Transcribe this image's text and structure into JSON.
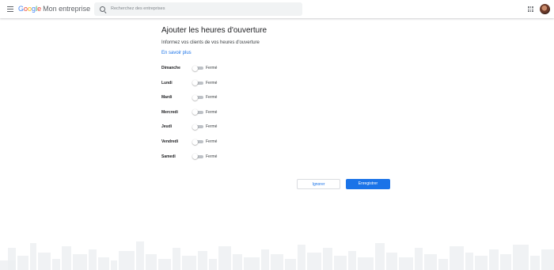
{
  "header": {
    "logo_google": "Google",
    "logo_product": "Mon entreprise",
    "search_placeholder": "Recherchez des entreprises"
  },
  "main": {
    "title": "Ajouter les heures d'ouverture",
    "subtitle": "Informez vos clients de vos heures d'ouverture",
    "learn_more": "En savoir plus"
  },
  "days": [
    {
      "name": "Dimanche",
      "status": "Fermé",
      "open": false
    },
    {
      "name": "Lundi",
      "status": "Fermé",
      "open": false
    },
    {
      "name": "Mardi",
      "status": "Fermé",
      "open": false
    },
    {
      "name": "Mercredi",
      "status": "Fermé",
      "open": false
    },
    {
      "name": "Jeudi",
      "status": "Fermé",
      "open": false
    },
    {
      "name": "Vendredi",
      "status": "Fermé",
      "open": false
    },
    {
      "name": "Samedi",
      "status": "Fermé",
      "open": false
    }
  ],
  "actions": {
    "ignore_label": "Ignorer",
    "save_label": "Enregistrer"
  },
  "colors": {
    "accent": "#1a73e8",
    "toggle_off": "#bdc1c6",
    "skyline": "#eceff1"
  },
  "icons": {
    "menu": "menu-icon",
    "search": "search-icon",
    "apps": "apps-grid-icon",
    "avatar": "user-avatar"
  }
}
